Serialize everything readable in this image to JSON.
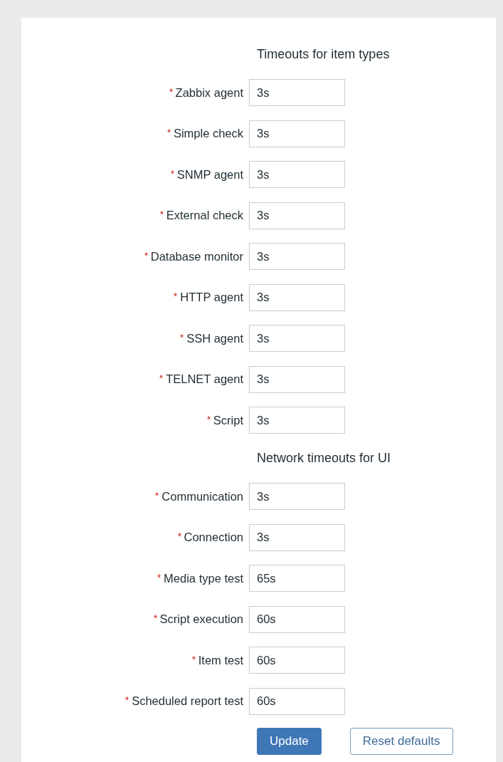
{
  "sections": [
    {
      "heading": "Timeouts for item types",
      "fields": [
        {
          "label": "Zabbix agent",
          "value": "3s",
          "required": true
        },
        {
          "label": "Simple check",
          "value": "3s",
          "required": true
        },
        {
          "label": "SNMP agent",
          "value": "3s",
          "required": true
        },
        {
          "label": "External check",
          "value": "3s",
          "required": true
        },
        {
          "label": "Database monitor",
          "value": "3s",
          "required": true
        },
        {
          "label": "HTTP agent",
          "value": "3s",
          "required": true
        },
        {
          "label": "SSH agent",
          "value": "3s",
          "required": true
        },
        {
          "label": "TELNET agent",
          "value": "3s",
          "required": true
        },
        {
          "label": "Script",
          "value": "3s",
          "required": true
        }
      ]
    },
    {
      "heading": "Network timeouts for UI",
      "fields": [
        {
          "label": "Communication",
          "value": "3s",
          "required": true
        },
        {
          "label": "Connection",
          "value": "3s",
          "required": true
        },
        {
          "label": "Media type test",
          "value": "65s",
          "required": true
        },
        {
          "label": "Script execution",
          "value": "60s",
          "required": true
        },
        {
          "label": "Item test",
          "value": "60s",
          "required": true
        },
        {
          "label": "Scheduled report test",
          "value": "60s",
          "required": true
        }
      ]
    }
  ],
  "buttons": [
    {
      "label": "Update",
      "kind": "primary"
    },
    {
      "label": "Reset defaults",
      "kind": "secondary"
    }
  ]
}
